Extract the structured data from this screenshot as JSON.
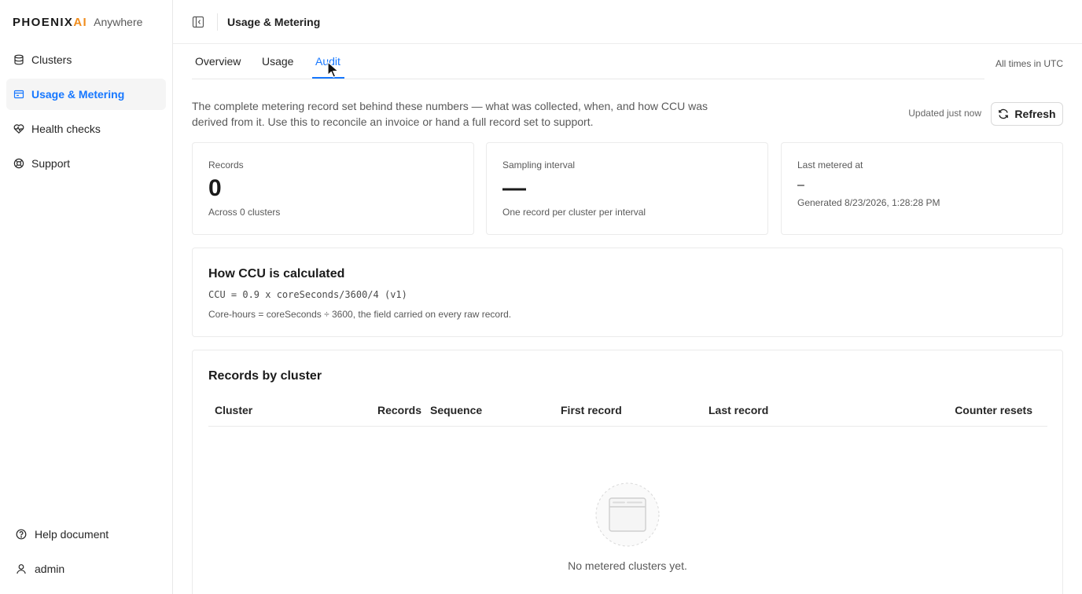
{
  "brand": {
    "logo_main": "PHOENIX",
    "logo_accent": "AI",
    "subtitle": "Anywhere"
  },
  "sidebar": {
    "items": [
      {
        "label": "Clusters",
        "icon": "database-icon",
        "active": false
      },
      {
        "label": "Usage & Metering",
        "icon": "receipt-icon",
        "active": true
      },
      {
        "label": "Health checks",
        "icon": "heart-pulse-icon",
        "active": false
      },
      {
        "label": "Support",
        "icon": "lifebuoy-icon",
        "active": false
      }
    ],
    "help_label": "Help document",
    "user_label": "admin"
  },
  "header": {
    "title": "Usage & Metering"
  },
  "tabs": {
    "items": [
      "Overview",
      "Usage",
      "Audit"
    ],
    "active": "Audit",
    "timezone_note": "All times in UTC"
  },
  "intro": {
    "description": "The complete metering record set behind these numbers — what was collected, when, and how CCU was derived from it. Use this to reconcile an invoice or hand a full record set to support.",
    "updated": "Updated just now",
    "refresh_label": "Refresh"
  },
  "stats": [
    {
      "label": "Records",
      "value": "0",
      "sub": "Across 0 clusters"
    },
    {
      "label": "Sampling interval",
      "value": "—",
      "sub": "One record per cluster per interval"
    },
    {
      "label": "Last metered at",
      "value": "–",
      "sub": "Generated 8/23/2026, 1:28:28 PM"
    }
  ],
  "ccu": {
    "title": "How CCU is calculated",
    "formula": "CCU = 0.9 x coreSeconds/3600/4 (v1)",
    "note": "Core-hours = coreSeconds ÷ 3600, the field carried on every raw record."
  },
  "records": {
    "title": "Records by cluster",
    "columns": [
      "Cluster",
      "Records",
      "Sequence",
      "First record",
      "Last record",
      "Counter resets"
    ],
    "rows": [],
    "empty_text": "No metered clusters yet."
  },
  "colors": {
    "accent": "#1677ff",
    "brand_accent": "#f08c1c"
  }
}
